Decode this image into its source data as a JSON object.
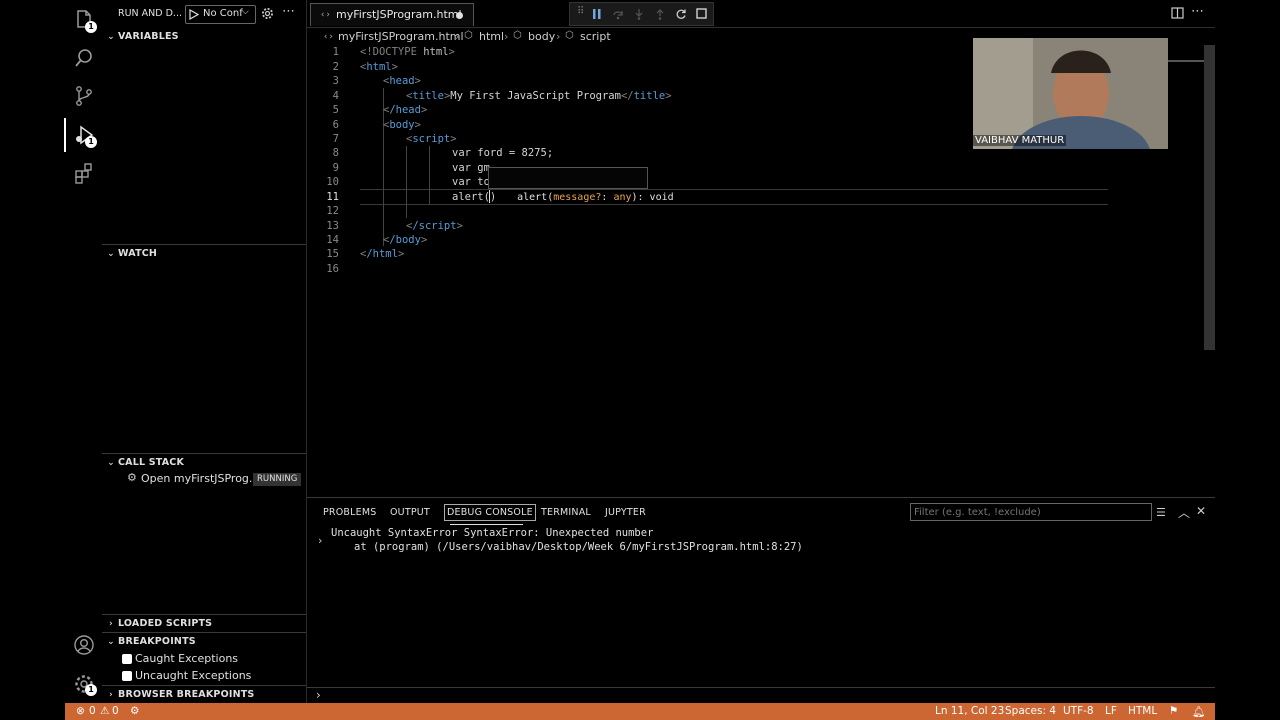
{
  "activity_bar": {
    "explorer_badge": "1",
    "debug_badge": "1",
    "settings_badge": "1"
  },
  "sidebar": {
    "title": "RUN AND D...",
    "config_select": "No Conf",
    "variables": "VARIABLES",
    "watch": "WATCH",
    "call_stack": "CALL STACK",
    "call_stack_item": "Open myFirstJSProg...",
    "call_stack_status": "RUNNING",
    "loaded_scripts": "LOADED SCRIPTS",
    "breakpoints": "BREAKPOINTS",
    "caught_exceptions": "Caught Exceptions",
    "uncaught_exceptions": "Uncaught Exceptions",
    "browser_breakpoints": "BROWSER BREAKPOINTS"
  },
  "editor": {
    "tab_label": "myFirstJSProgram.html",
    "breadcrumb": {
      "file": "myFirstJSProgram.html",
      "html": "html",
      "body": "body",
      "script": "script"
    },
    "line_numbers": [
      "1",
      "2",
      "3",
      "4",
      "5",
      "6",
      "7",
      "8",
      "9",
      "10",
      "11",
      "12",
      "13",
      "14",
      "15",
      "16"
    ],
    "code": {
      "l1_open": "<!DOCTYPE",
      "l1_kw": " html",
      "l1_close": ">",
      "l2": "html",
      "l3": "head",
      "l4_tag": "title",
      "l4_text": "My First JavaScript Program",
      "l5": "/head",
      "l6": "body",
      "l7": "script",
      "l8": "var ford = 8275;",
      "l9": "var gm",
      "l10": "var to",
      "l11": "alert()",
      "l13": "/script",
      "l14": "/body",
      "l15": "/html"
    },
    "hover": {
      "fn": "alert(",
      "param": "message?",
      "colon": ": ",
      "type": "any",
      "ret": "): void"
    }
  },
  "webcam": {
    "name": "VAIBHAV MATHUR"
  },
  "panel": {
    "tabs": [
      "PROBLEMS",
      "OUTPUT",
      "DEBUG CONSOLE",
      "TERMINAL",
      "JUPYTER"
    ],
    "filter_placeholder": "Filter (e.g. text, !exclude)",
    "error_line1": "Uncaught SyntaxError SyntaxError: Unexpected number",
    "error_line2": "at (program) (/Users/vaibhav/Desktop/Week 6/myFirstJSProgram.html:8:27)"
  },
  "status_bar": {
    "errors": "0",
    "warnings": "0",
    "position": "Ln 11, Col 23",
    "spaces": "Spaces: 4",
    "encoding": "UTF-8",
    "eol": "LF",
    "language": "HTML"
  },
  "colors": {
    "status_bar": "#cc6633",
    "accent": "#569cd6"
  }
}
